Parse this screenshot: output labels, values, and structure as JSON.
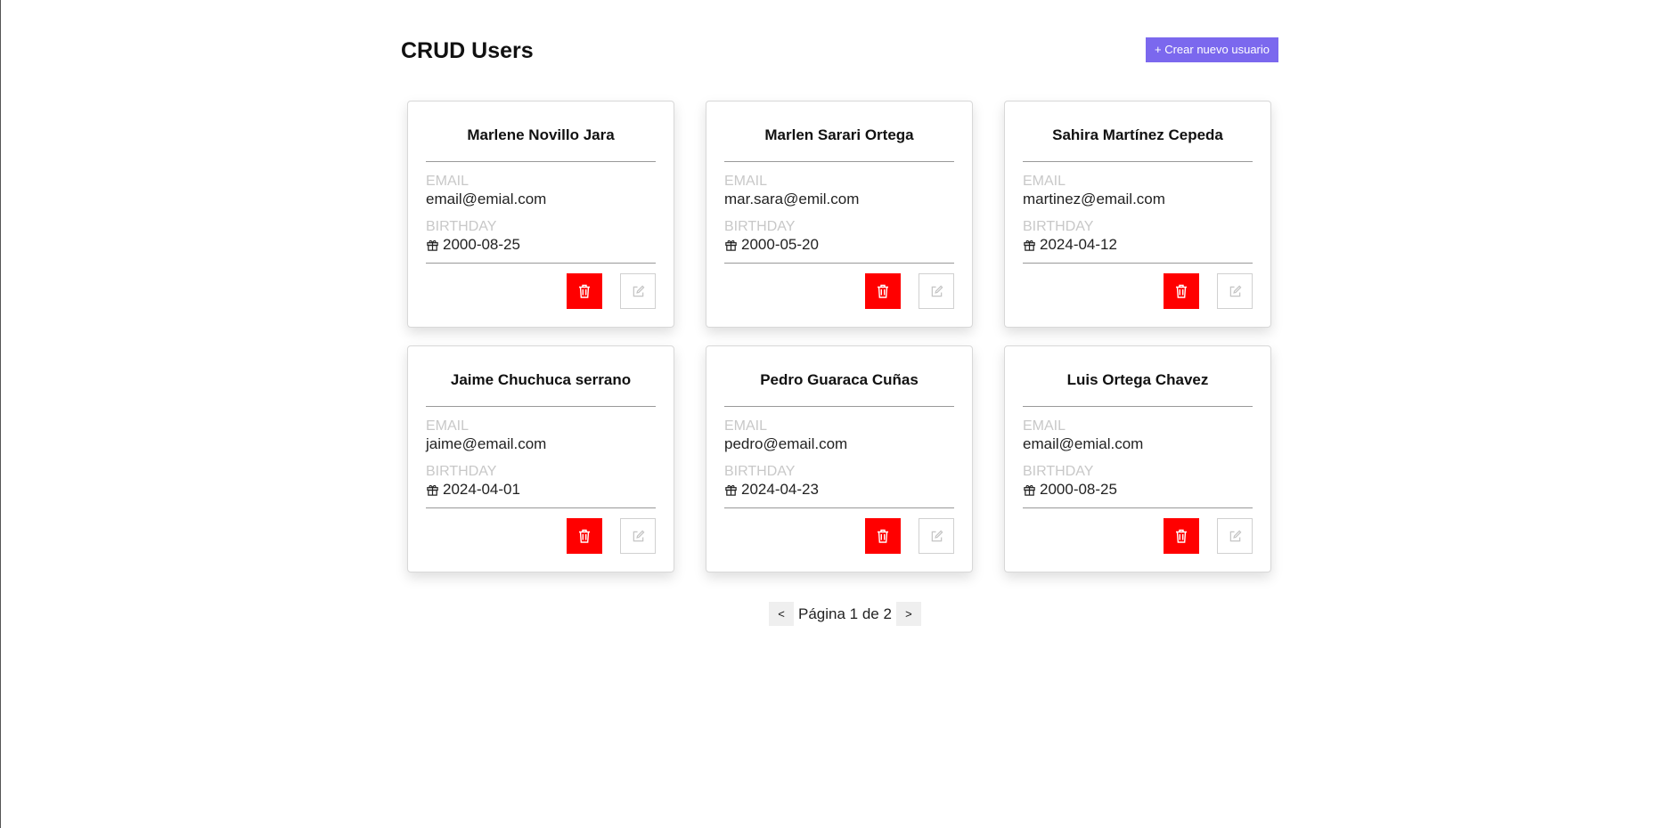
{
  "header": {
    "title": "CRUD Users",
    "create_button_label": "+ Crear nuevo usuario"
  },
  "labels": {
    "email": "EMAIL",
    "birthday": "BIRTHDAY"
  },
  "users": [
    {
      "name": "Marlene Novillo Jara",
      "email": "email@emial.com",
      "birthday": "2000-08-25"
    },
    {
      "name": "Marlen Sarari Ortega",
      "email": "mar.sara@emil.com",
      "birthday": "2000-05-20"
    },
    {
      "name": "Sahira Martínez Cepeda",
      "email": "martinez@email.com",
      "birthday": "2024-04-12"
    },
    {
      "name": "Jaime Chuchuca serrano",
      "email": "jaime@email.com",
      "birthday": "2024-04-01"
    },
    {
      "name": "Pedro Guaraca Cuñas",
      "email": "pedro@email.com",
      "birthday": "2024-04-23"
    },
    {
      "name": "Luis Ortega Chavez",
      "email": "email@emial.com",
      "birthday": "2000-08-25"
    }
  ],
  "pagination": {
    "prev_label": "<",
    "next_label": ">",
    "status_text": "Página 1 de 2"
  },
  "colors": {
    "accent": "#7b68ee",
    "delete": "#ff0000"
  },
  "icons": {
    "birthday": "gift-icon",
    "delete": "trash-icon",
    "edit": "edit-icon"
  }
}
